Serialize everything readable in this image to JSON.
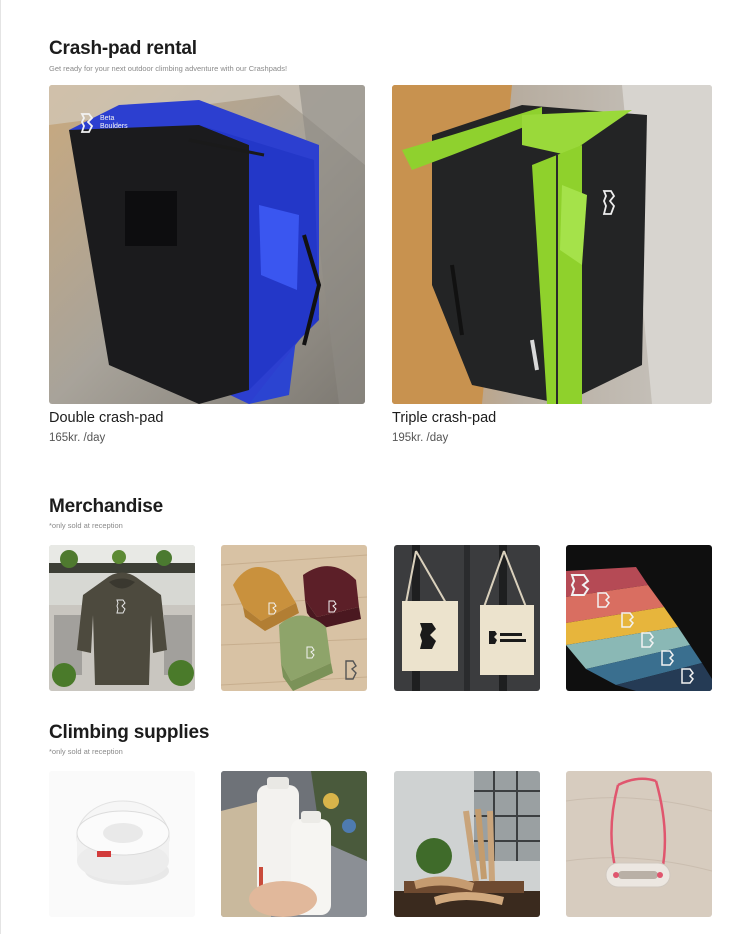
{
  "rental": {
    "title": "Crash-pad rental",
    "subtitle": "Get ready for your next outdoor climbing adventure with our Crashpads!",
    "products": [
      {
        "name": "Double crash-pad",
        "price": "165kr. /day",
        "accent": "#2a3fcf"
      },
      {
        "name": "Triple crash-pad",
        "price": "195kr. /day",
        "accent": "#8ed62a"
      }
    ]
  },
  "merch": {
    "title": "Merchandise",
    "note": "*only sold at reception",
    "items": [
      "hoodie",
      "beanies",
      "tote-bags",
      "t-shirts"
    ]
  },
  "supplies": {
    "title": "Climbing supplies",
    "note": "*only sold at reception",
    "items": [
      "tape",
      "liquid-chalk",
      "brushes",
      "finger-ring"
    ]
  },
  "colors": {
    "logo_text": "#f2f2f2",
    "heading": "#1c1c1c",
    "muted": "#8a8a8a"
  },
  "logo_text": {
    "line1": "Beta",
    "line2": "Boulders"
  }
}
